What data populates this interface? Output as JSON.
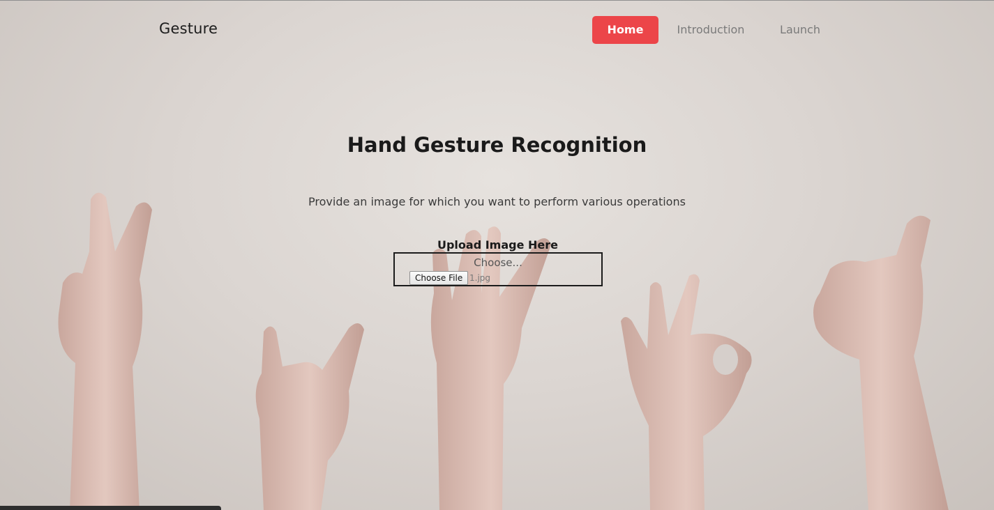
{
  "navbar": {
    "brand": "Gesture",
    "links": [
      {
        "label": "Home",
        "active": true
      },
      {
        "label": "Introduction",
        "active": false
      },
      {
        "label": "Launch",
        "active": false
      }
    ]
  },
  "hero": {
    "title": "Hand Gesture Recognition",
    "subtitle": "Provide an image for which you want to perform various operations"
  },
  "upload": {
    "label": "Upload Image Here",
    "placeholder": "Choose...",
    "button_label": "Choose File",
    "file_name": "1.jpg"
  },
  "colors": {
    "accent": "#ec4549",
    "background": "#dbd5d1",
    "text": "#1a1a1a"
  }
}
